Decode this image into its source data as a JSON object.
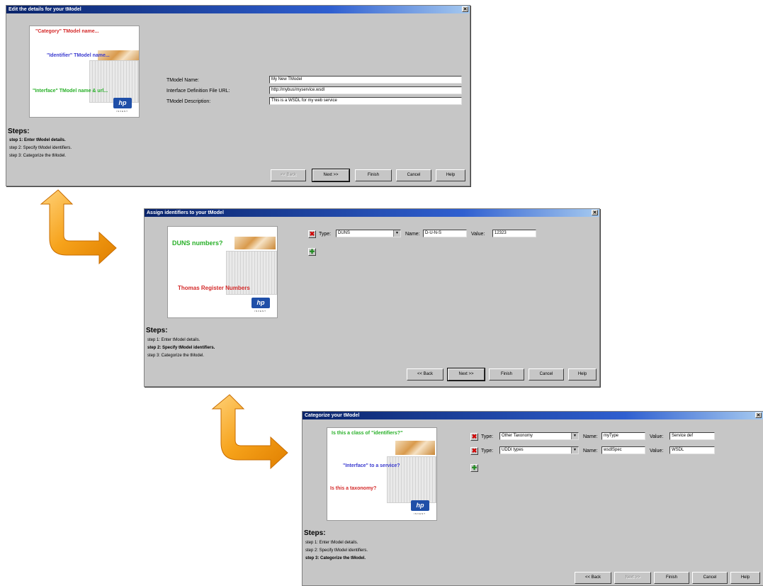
{
  "window1": {
    "title": "Edit the details for your tModel",
    "close_label": "✕",
    "art": {
      "line1": "\"Category\" TModel name...",
      "line2": "\"Identifier\" TModel name...",
      "line3": "\"Interface\" TModel name & url...",
      "logo": "hp",
      "logo_sub": "INVENT"
    },
    "form": {
      "name_label": "TModel Name:",
      "name_value": "My New TModel",
      "url_label": "Interface Definition File URL:",
      "url_value": "http://mybus/myservice.wsdl",
      "desc_label": "TModel Description:",
      "desc_value": "This is a WSDL for my web service"
    },
    "steps_title": "Steps:",
    "steps": [
      "step 1: Enter tModel details.",
      "step 2: Specify tModel identifiers.",
      "step 3: Categorize the tModel."
    ],
    "buttons": {
      "back": "<< Back",
      "next": "Next >>",
      "finish": "Finish",
      "cancel": "Cancel",
      "help": "Help"
    }
  },
  "window2": {
    "title": "Assign identifiers to your tModel",
    "close_label": "✕",
    "art": {
      "line1": "DUNS numbers?",
      "line2": "Thomas Register Numbers",
      "logo": "hp",
      "logo_sub": "INVENT"
    },
    "row": {
      "type_label": "Type:",
      "type_value": "DUNS",
      "name_label": "Name:",
      "name_value": "D-U-N-S",
      "value_label": "Value:",
      "value_value": "12323"
    },
    "steps_title": "Steps:",
    "steps": [
      "step 1: Enter tModel details.",
      "step 2: Specify tModel identifiers.",
      "step 3: Categorize the tModel."
    ],
    "buttons": {
      "back": "<< Back",
      "next": "Next >>",
      "finish": "Finish",
      "cancel": "Cancel",
      "help": "Help"
    }
  },
  "window3": {
    "title": "Categorize your tModel",
    "close_label": "✕",
    "art": {
      "line1": "Is this a class of \"identifiers?\"",
      "line2": "\"Interface\" to a service?",
      "line3": "Is this a taxonomy?",
      "logo": "hp",
      "logo_sub": "INVENT"
    },
    "rows": [
      {
        "type_label": "Type:",
        "type_value": "Other Taxonomy",
        "name_label": "Name:",
        "name_value": "myType",
        "value_label": "Value:",
        "value_value": "Service def"
      },
      {
        "type_label": "Type:",
        "type_value": "UDDI types",
        "name_label": "Name:",
        "name_value": "wsdlSpec",
        "value_label": "Value:",
        "value_value": "WSDL"
      }
    ],
    "steps_title": "Steps:",
    "steps": [
      "step 1: Enter tModel details.",
      "step 2: Specify tModel identifiers.",
      "step 3: Categorize the tModel."
    ],
    "buttons": {
      "back": "<< Back",
      "next": "Next >>",
      "finish": "Finish",
      "cancel": "Cancel",
      "help": "Help"
    }
  },
  "icons": {
    "delete": "delete-row-icon",
    "add": "add-row-icon",
    "dropdown": "chevron-down-icon",
    "flow_arrow": "flow-arrow-icon"
  },
  "colors": {
    "title_bar": "#0a246a",
    "dialog_bg": "#c6c6c6",
    "arrow": "#f6a21a",
    "art_red": "#d42a2a",
    "art_blue": "#3b3bd0",
    "art_green": "#28b028"
  }
}
